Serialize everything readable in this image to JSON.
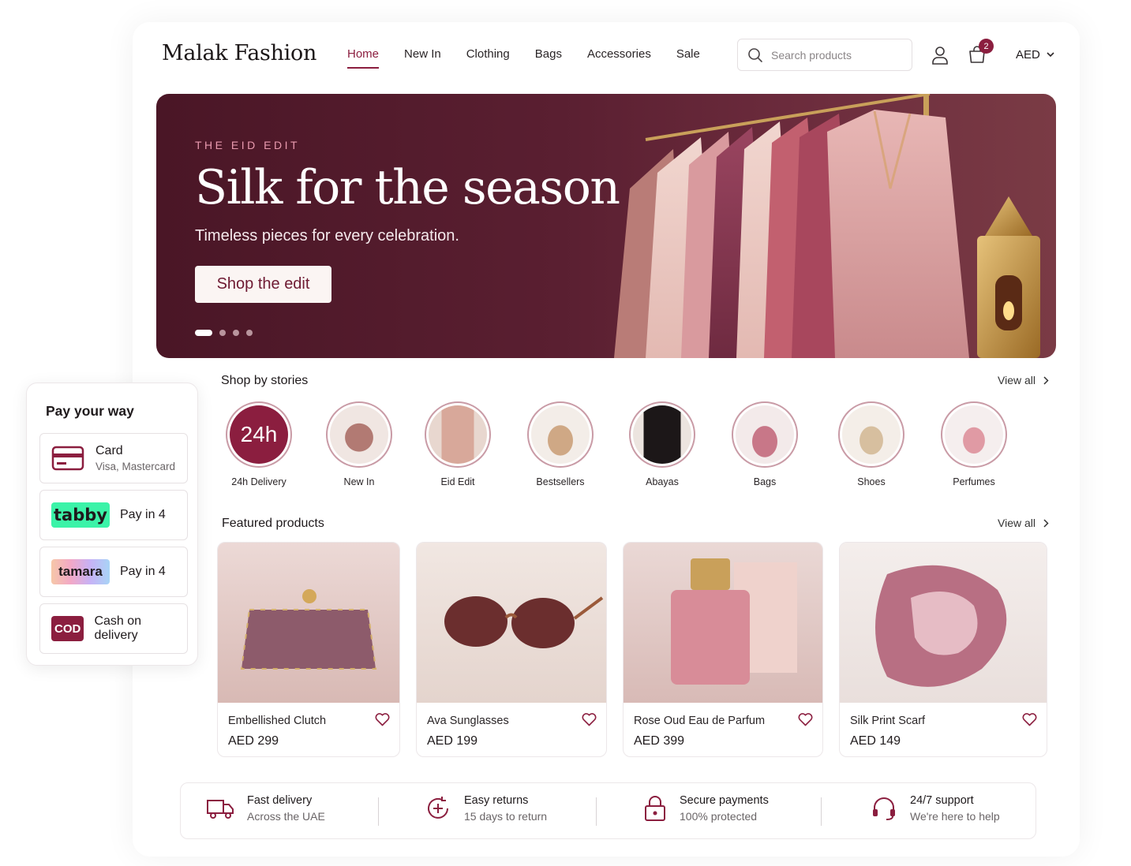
{
  "brand": "Malak Fashion",
  "nav": [
    "Home",
    "New In",
    "Clothing",
    "Bags",
    "Accessories",
    "Sale"
  ],
  "search_placeholder": "Search products",
  "cart_count": "2",
  "currency": "AED",
  "hero": {
    "kicker": "THE EID EDIT",
    "title": "Silk for the season",
    "subtitle": "Timeless pieces for every celebration.",
    "button": "Shop the edit"
  },
  "stories": {
    "title": "Shop by stories",
    "view_all": "View all",
    "badge_text": "24h",
    "items": [
      "24h Delivery",
      "New In",
      "Eid Edit",
      "Bestsellers",
      "Abayas",
      "Bags",
      "Shoes",
      "Perfumes"
    ]
  },
  "featured": {
    "title": "Featured products",
    "view_all": "View all",
    "items": [
      {
        "name": "Embellished Clutch",
        "price": "AED 299"
      },
      {
        "name": "Ava Sunglasses",
        "price": "AED 199"
      },
      {
        "name": "Rose Oud Eau de Parfum",
        "price": "AED 399"
      },
      {
        "name": "Silk Print Scarf",
        "price": "AED 149"
      }
    ]
  },
  "features": [
    {
      "title": "Fast delivery",
      "sub": "Across the UAE"
    },
    {
      "title": "Easy returns",
      "sub": "15 days to return"
    },
    {
      "title": "Secure payments",
      "sub": "100% protected"
    },
    {
      "title": "24/7 support",
      "sub": "We're here to help"
    }
  ],
  "pay": {
    "title": "Pay your way",
    "card_label": "Card",
    "card_sub": "Visa, Mastercard",
    "tabby_logo": "tabby",
    "tabby_label": "Pay in 4",
    "tamara_logo": "tamara",
    "tamara_label": "Pay in 4",
    "cod_logo": "COD",
    "cod_label": "Cash on delivery"
  },
  "colors": {
    "accent": "#8b1e3f",
    "hero_bg": "#4a1626",
    "tabby": "#3bf3a8"
  }
}
